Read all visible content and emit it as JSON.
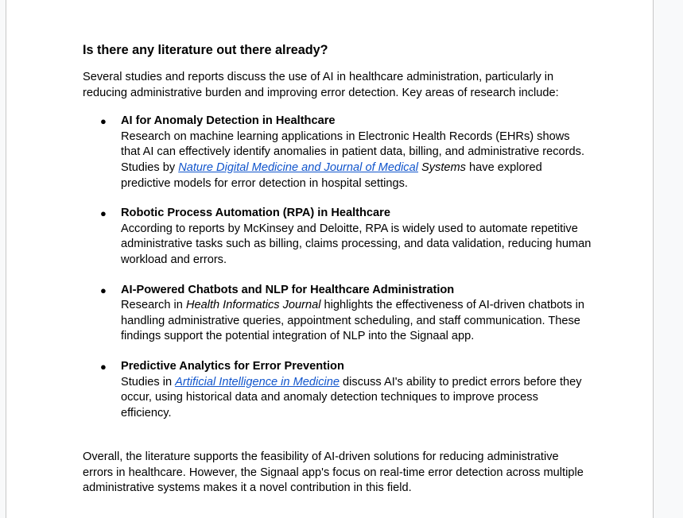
{
  "heading": "Is there any literature out there already?",
  "intro": "Several studies and reports discuss the use of AI in healthcare administration, particularly in reducing administrative burden and improving error detection. Key areas of research include:",
  "bullet_glyph": "●",
  "items": [
    {
      "title": "AI for Anomaly Detection in Healthcare",
      "body_pre": " Research on machine learning applications in Electronic Health Records (EHRs) shows that AI can effectively identify anomalies in patient data, billing, and administrative records. Studies by ",
      "link": "Nature Digital Medicine and Journal of Medical",
      "italic": " Systems",
      "body_post": " have explored predictive models for error detection in hospital settings."
    },
    {
      "title": "Robotic Process Automation (RPA) in Healthcare",
      "body_pre": " According to reports by McKinsey and Deloitte, RPA is widely used to automate repetitive administrative tasks such as billing, claims processing, and data validation, reducing human workload and errors."
    },
    {
      "title": "AI-Powered Chatbots and NLP for Healthcare Administration",
      "body_pre": " Research in ",
      "italic": "Health Informatics Journal",
      "body_post": " highlights the effectiveness of AI-driven chatbots in handling administrative queries, appointment scheduling, and staff communication. These findings support the potential integration of NLP into the Signaal app."
    },
    {
      "title": "Predictive Analytics for Error Prevention",
      "body_pre": "  Studies in ",
      "link": "Artificial Intelligence in Medicine",
      "body_post": " discuss AI's ability to predict errors before they occur, using historical data and anomaly detection techniques to improve process efficiency."
    }
  ],
  "conclusion": "Overall, the literature supports the feasibility of AI-driven solutions for reducing administrative errors in healthcare. However, the Signaal app's focus on real-time error detection across multiple administrative systems makes it a novel contribution in this field."
}
